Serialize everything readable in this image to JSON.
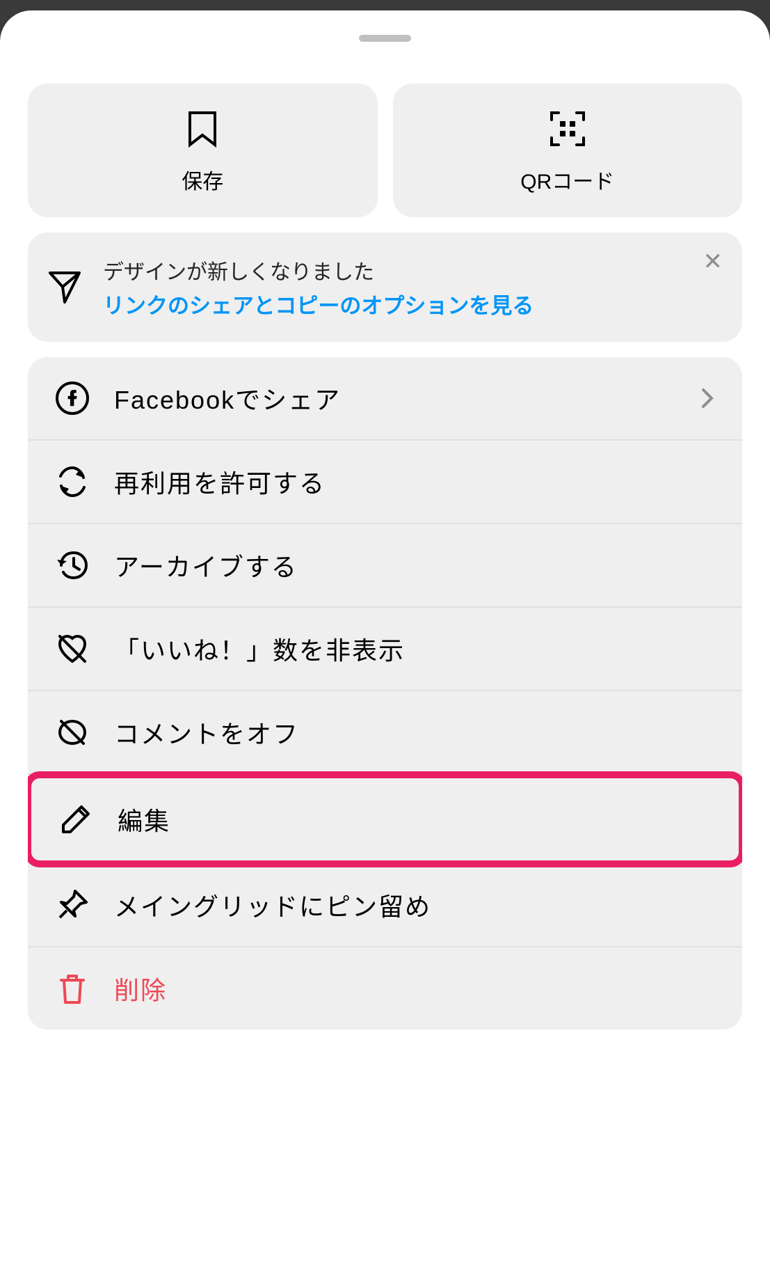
{
  "topButtons": {
    "save": {
      "label": "保存"
    },
    "qrcode": {
      "label": "QRコード"
    }
  },
  "notice": {
    "title": "デザインが新しくなりました",
    "link": "リンクのシェアとコピーのオプションを見る"
  },
  "menu": {
    "facebook_share": "Facebookでシェア",
    "allow_reuse": "再利用を許可する",
    "archive": "アーカイブする",
    "hide_likes": "「いいね！」数を非表示",
    "comments_off": "コメントをオフ",
    "edit": "編集",
    "pin": "メイングリッドにピン留め",
    "delete": "削除"
  }
}
